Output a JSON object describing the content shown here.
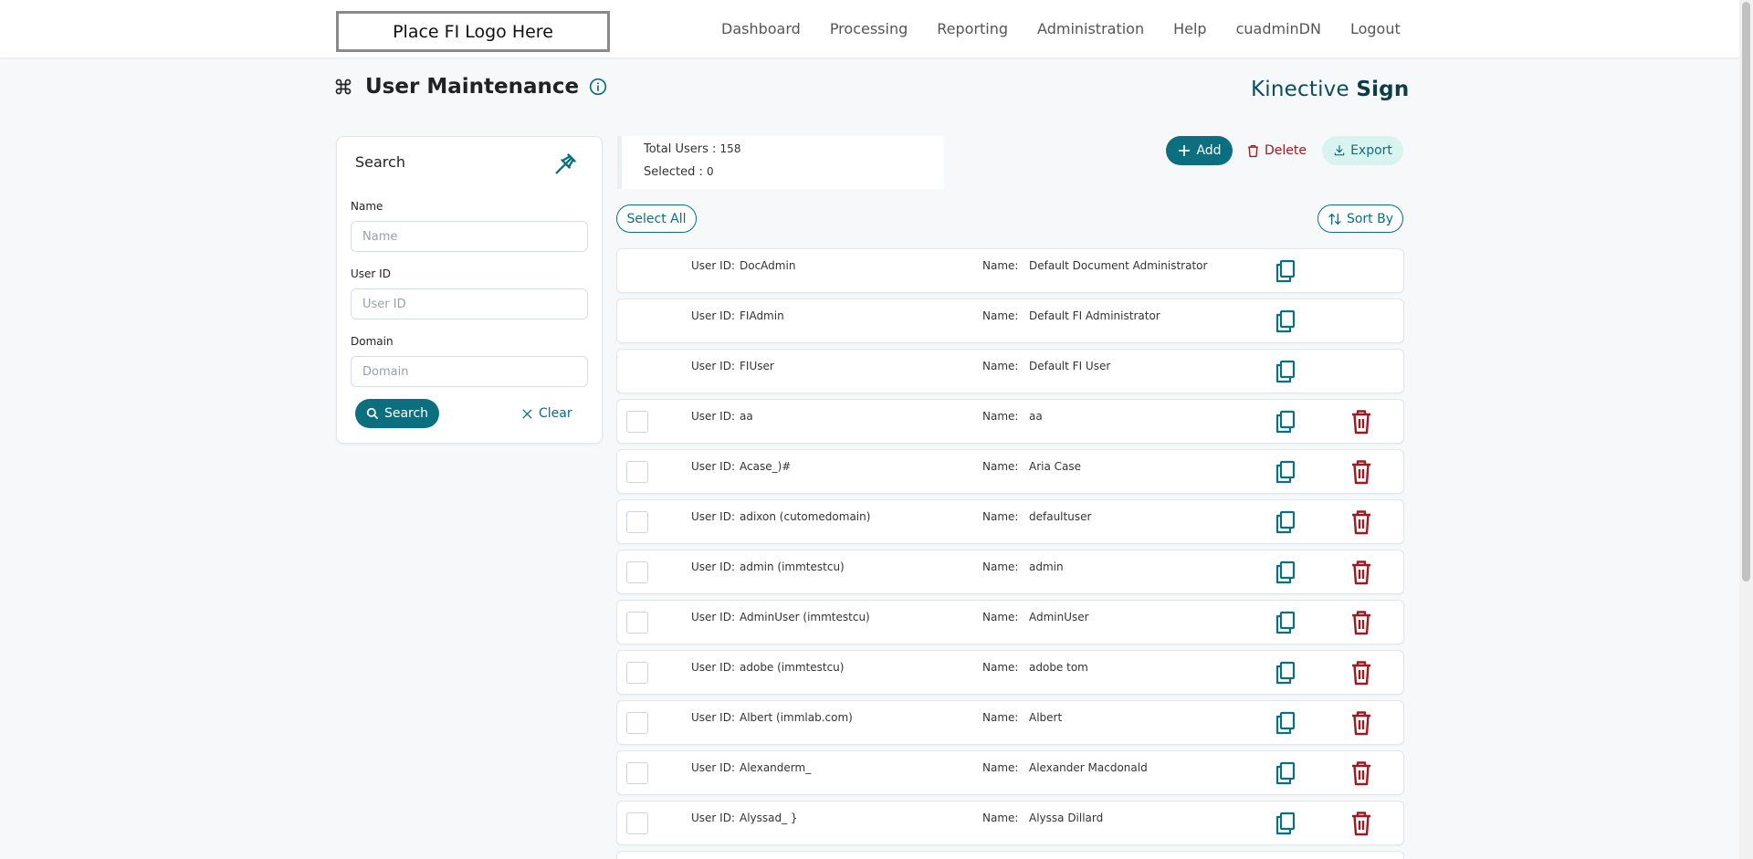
{
  "header": {
    "logo_text": "Place FI Logo Here",
    "nav": [
      "Dashboard",
      "Processing",
      "Reporting",
      "Administration",
      "Help",
      "cuadminDN",
      "Logout"
    ]
  },
  "page": {
    "title": "User Maintenance",
    "brand_light": "Kinective ",
    "brand_bold": "Sign"
  },
  "search": {
    "title": "Search",
    "name_label": "Name",
    "name_placeholder": "Name",
    "userid_label": "User ID",
    "userid_placeholder": "User ID",
    "domain_label": "Domain",
    "domain_placeholder": "Domain",
    "search_button": "Search",
    "clear_button": "Clear"
  },
  "summary": {
    "total_label": "Total Users : ",
    "total_value": "158",
    "selected_label": "Selected : ",
    "selected_value": "0"
  },
  "actions": {
    "add": "Add",
    "delete": "Delete",
    "export": "Export",
    "select_all": "Select All",
    "sort_by": "Sort By"
  },
  "labels": {
    "user_id": "User ID:",
    "name": "Name:"
  },
  "colors": {
    "primary": "#0b6f80",
    "danger": "#9b1b22",
    "export_bg": "#d9f3ef"
  },
  "users": [
    {
      "user_id": "DocAdmin",
      "name": "Default Document Administrator",
      "selectable": false
    },
    {
      "user_id": "FIAdmin",
      "name": "Default FI Administrator",
      "selectable": false
    },
    {
      "user_id": "FIUser",
      "name": "Default FI User",
      "selectable": false
    },
    {
      "user_id": "aa",
      "name": "aa",
      "selectable": true
    },
    {
      "user_id": "Acase_)#",
      "name": "Aria Case",
      "selectable": true
    },
    {
      "user_id": "adixon (cutomedomain)",
      "name": "defaultuser",
      "selectable": true
    },
    {
      "user_id": "admin (immtestcu)",
      "name": "admin",
      "selectable": true
    },
    {
      "user_id": "AdminUser (immtestcu)",
      "name": "AdminUser",
      "selectable": true
    },
    {
      "user_id": "adobe (immtestcu)",
      "name": "adobe tom",
      "selectable": true
    },
    {
      "user_id": "Albert (immlab.com)",
      "name": "Albert",
      "selectable": true
    },
    {
      "user_id": "Alexanderm_",
      "name": "Alexander Macdonald",
      "selectable": true
    },
    {
      "user_id": "Alyssad_ }",
      "name": "Alyssa Dillard",
      "selectable": true
    },
    {
      "user_id": "",
      "name": "",
      "selectable": true
    }
  ]
}
